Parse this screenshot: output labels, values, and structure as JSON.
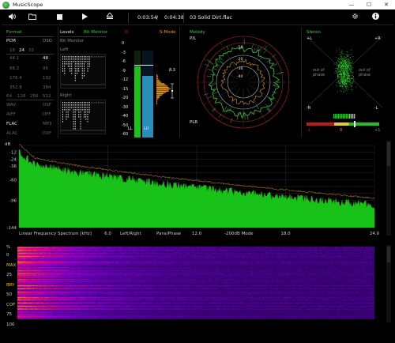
{
  "app": {
    "title": "MusicScope"
  },
  "window_controls": {
    "minimize": "—",
    "maximize": "☐",
    "close": "✕"
  },
  "toolbar": {
    "time_current": "0:03:54",
    "time_sep": "/",
    "time_total": "0:04:38",
    "track": "03 Solid Dirt.flac"
  },
  "format": {
    "title": "Format",
    "pcm": "PCM",
    "dsd": "DSD",
    "bits": [
      "16",
      "24",
      "32"
    ],
    "rates": [
      [
        "44.1",
        "48"
      ],
      [
        "88.2",
        "96"
      ],
      [
        "176.4",
        "192"
      ],
      [
        "352.8",
        "384"
      ]
    ],
    "dsd_rates": [
      "64",
      "128",
      "256",
      "512"
    ],
    "formats": [
      [
        "WAV",
        "DSF"
      ],
      [
        "AIFF",
        "DFF"
      ],
      [
        "FLAC",
        "MP3"
      ],
      [
        "ALAC",
        "DXF"
      ]
    ]
  },
  "levels": {
    "title": "Levels",
    "bit_monitor_tab": "Bit Monitor",
    "bit_monitor_label": "Bit Monitor",
    "left": "Left",
    "right": "Right",
    "scale": [
      "0",
      "-3",
      "-6",
      "-9",
      "-12",
      "-15",
      "-20",
      "-30",
      "-40",
      "-50",
      "-60"
    ],
    "peak_left": "-12",
    "peak_right": "-18",
    "ll": "LL",
    "lu": "LU",
    "d_value": "8.3",
    "s_mode": "S-Mode"
  },
  "melody": {
    "title": "Melody",
    "pl": "P/L",
    "plr": "PLR",
    "db_rings": [
      "-10",
      "-20",
      "-30",
      "-40"
    ]
  },
  "stereo": {
    "title": "Stereo",
    "plus_l": "+L",
    "plus_r": "+R",
    "minus_l": "-R",
    "minus_r": "-L",
    "out_left": "out of phase",
    "out_right": "out of phase",
    "corr_min": "-1",
    "corr_mid": "0",
    "corr_max": "+1"
  },
  "spectrum": {
    "db_label": "dB",
    "db_ticks": [
      "0",
      "-12",
      "-24",
      "-36",
      "-48",
      "-60",
      "-72",
      "-84",
      "-96",
      "-108",
      "-120",
      "-132",
      "-144"
    ],
    "db_shown": [
      "-12",
      "-24",
      "-36",
      "-60",
      "-96",
      "-100",
      "-144"
    ],
    "mode_label": "Linear Frequency Spectrum [kHz]",
    "freq_ticks": [
      "6.0",
      "12.0",
      "18.0",
      "24.0"
    ],
    "opt_left_right": "Left/Right",
    "opt_pans": "Pans/Phase",
    "opt_db_mode": "-200dB Mode"
  },
  "spectrogram": {
    "pct_label": "%",
    "row_labels": [
      "0",
      "MAX",
      "25",
      "BRY",
      "50",
      "COF",
      "75",
      "100"
    ]
  },
  "colors": {
    "accent_green": "#3cc83c",
    "accent_orange": "#e89a2a",
    "alert_red": "#d02020",
    "level_blue": "#2a8fb8"
  },
  "icons": {
    "volume": "speaker-icon",
    "open": "folder-icon",
    "stop": "stop-icon",
    "play": "play-icon",
    "eject": "eject-icon",
    "settings": "gear-icon",
    "info": "info-icon"
  }
}
